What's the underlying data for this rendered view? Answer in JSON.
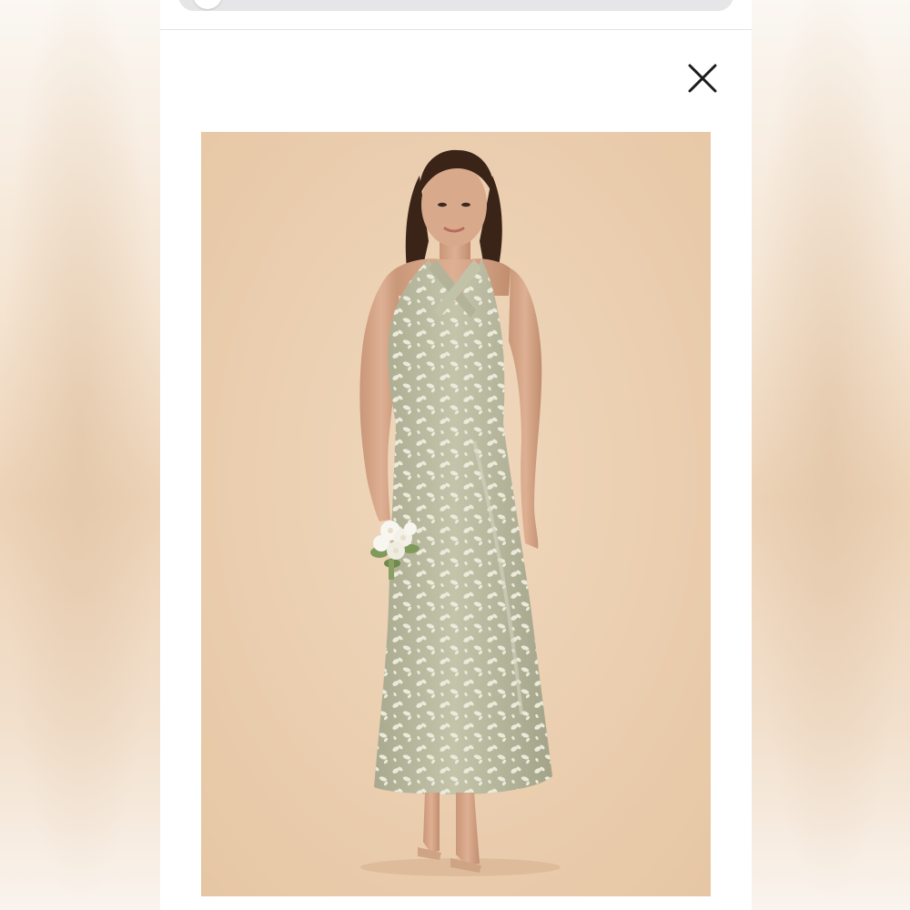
{
  "topbar": {
    "search_icon": "search-field-pill"
  },
  "modal": {
    "close_icon": "close-icon"
  },
  "product_image": {
    "backdrop_color": "#ecd1b4",
    "dress_color": "#b8b8a0",
    "print_color": "#ecead8"
  }
}
